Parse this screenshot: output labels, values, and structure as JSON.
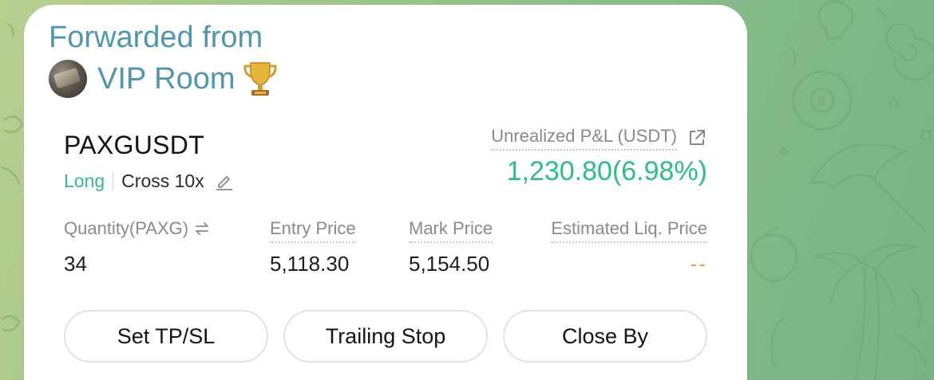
{
  "forward": {
    "title": "Forwarded from",
    "source": "VIP Room",
    "avatar_icon": "money-stack-avatar",
    "badge_icon": "trophy-icon"
  },
  "position": {
    "symbol": "PAXGUSDT",
    "side": "Long",
    "margin_mode": "Cross 10x",
    "pnl_label": "Unrealized P&L (USDT)",
    "pnl_value": "1,230.80(6.98%)",
    "columns": {
      "quantity_label": "Quantity(PAXG)",
      "quantity_value": "34",
      "entry_label": "Entry Price",
      "entry_value": "5,118.30",
      "mark_label": "Mark Price",
      "mark_value": "5,154.50",
      "liq_label": "Estimated Liq. Price",
      "liq_value": "--"
    }
  },
  "actions": {
    "set_tp_sl": "Set TP/SL",
    "trailing_stop": "Trailing Stop",
    "close_by": "Close By"
  },
  "colors": {
    "accent_link": "#4f97ad",
    "profit_green": "#2ebd85",
    "liq_orange": "#f0a24b",
    "muted_label": "#8a8a8a"
  }
}
